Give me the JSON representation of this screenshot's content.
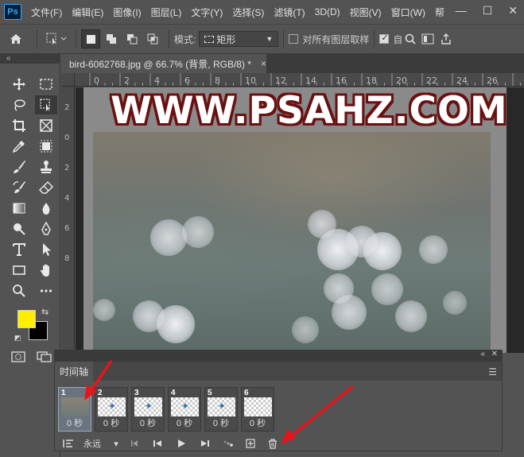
{
  "menubar": {
    "logo": "Ps",
    "items": [
      "文件(F)",
      "编辑(E)",
      "图像(I)",
      "图层(L)",
      "文字(Y)",
      "选择(S)",
      "滤镜(T)",
      "3D(D)",
      "视图(V)",
      "窗口(W)",
      "帮"
    ],
    "window_controls": [
      "—",
      "☐",
      "✕"
    ]
  },
  "options": {
    "mode_label": "模式:",
    "mode_value": "矩形",
    "all_layers_label": "对所有图层取样",
    "auto_label": "自"
  },
  "document": {
    "tab_title": "bird-6062768.jpg @ 66.7% (背景, RGB/8) *",
    "close": "×",
    "collapse": "«",
    "watermark": "WWW.PSAHZ.COM",
    "ruler_top": [
      "0",
      "2",
      "4",
      "6",
      "8",
      "10",
      "12",
      "14",
      "16",
      "18",
      "20",
      "22",
      "24",
      "26"
    ],
    "ruler_left": [
      "2",
      "0",
      "2",
      "4",
      "6",
      "8"
    ]
  },
  "colors": {
    "foreground": "#ffee00",
    "background": "#000000",
    "watermark_stroke": "#6a1010"
  },
  "timeline": {
    "collapse": "«",
    "close": "✕",
    "tab_label": "时间轴",
    "frames": [
      {
        "num": "1",
        "delay": "0 秒",
        "selected": true
      },
      {
        "num": "2",
        "delay": "0 秒",
        "selected": false
      },
      {
        "num": "3",
        "delay": "0 秒",
        "selected": false
      },
      {
        "num": "4",
        "delay": "0 秒",
        "selected": false
      },
      {
        "num": "5",
        "delay": "0 秒",
        "selected": false
      },
      {
        "num": "6",
        "delay": "0 秒",
        "selected": false
      }
    ],
    "loop_label": "永远"
  }
}
